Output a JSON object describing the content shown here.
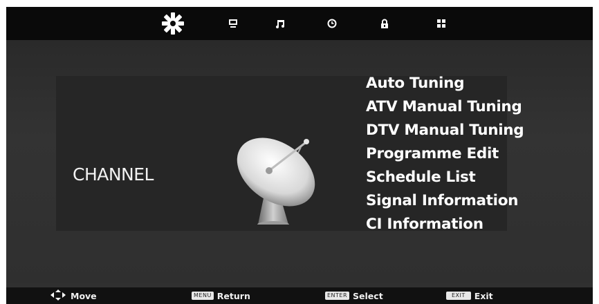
{
  "tabs": [
    {
      "icon": "picture-settings-icon",
      "active": true
    },
    {
      "icon": "monitor-icon",
      "active": false
    },
    {
      "icon": "music-note-icon",
      "active": false
    },
    {
      "icon": "clock-icon",
      "active": false
    },
    {
      "icon": "lock-icon",
      "active": false
    },
    {
      "icon": "grid-icon",
      "active": false
    }
  ],
  "section": {
    "title": "CHANNEL",
    "illustration": "satellite-dish-icon"
  },
  "menu": {
    "items": [
      "Auto Tuning",
      "ATV Manual Tuning",
      "DTV Manual Tuning",
      "Programme Edit",
      "Schedule List",
      "Signal Information",
      "CI Information"
    ]
  },
  "footer": {
    "move_label": "Move",
    "return_key": "MENU",
    "return_label": "Return",
    "select_key": "ENTER",
    "select_label": "Select",
    "exit_key": "EXIT",
    "exit_label": "Exit"
  },
  "colors": {
    "background": "#303030",
    "topbar": "#0a0a0a",
    "text": "#ffffff"
  }
}
